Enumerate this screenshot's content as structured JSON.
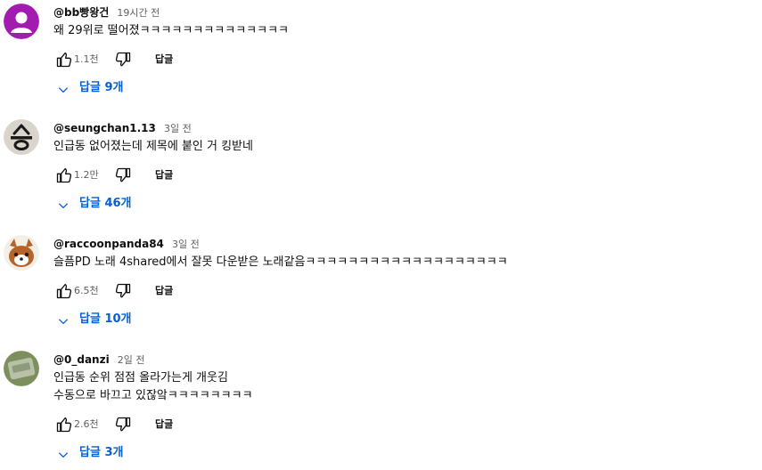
{
  "comments": [
    {
      "author": "@bb빵왕건",
      "time": "19시간 전",
      "lines": [
        "왜 29위로 떨어졌ㅋㅋㅋㅋㅋㅋㅋㅋㅋㅋㅋㅋㅋㅋ"
      ],
      "likes": "1.1천",
      "reply_label": "답글",
      "replies": "답글 9개",
      "avatar_icon": "purple-default-avatar-icon",
      "avatar_color": "#9c27b0"
    },
    {
      "author": "@seungchan1.13",
      "time": "3일 전",
      "lines": [
        "인급동 없어졌는데 제목에 붙인 거 킹받네"
      ],
      "likes": "1.2만",
      "reply_label": "답글",
      "replies": "답글 46개",
      "avatar_icon": "hangul-seung-avatar-icon"
    },
    {
      "author": "@raccoonpanda84",
      "time": "3일 전",
      "lines": [
        "슬픔PD 노래 4shared에서 잘못 다운받은 노래같음ㅋㅋㅋㅋㅋㅋㅋㅋㅋㅋㅋㅋㅋㅋㅋㅋㅋㅋㅋ"
      ],
      "likes": "6.5천",
      "reply_label": "답글",
      "replies": "답글 10개",
      "avatar_icon": "red-panda-avatar-icon"
    },
    {
      "author": "@0_danzi",
      "time": "2일 전",
      "lines": [
        "인급동 순위 점점 올라가는게 개웃김",
        "수동으로 바끄고 있잖앜ㅋㅋㅋㅋㅋㅋㅋㅋ"
      ],
      "likes": "2.6천",
      "reply_label": "답글",
      "replies": "답글 3개",
      "avatar_icon": "green-stone-avatar-icon"
    }
  ],
  "colors": {
    "link_blue": "#065fd4",
    "secondary_text": "#606060"
  }
}
